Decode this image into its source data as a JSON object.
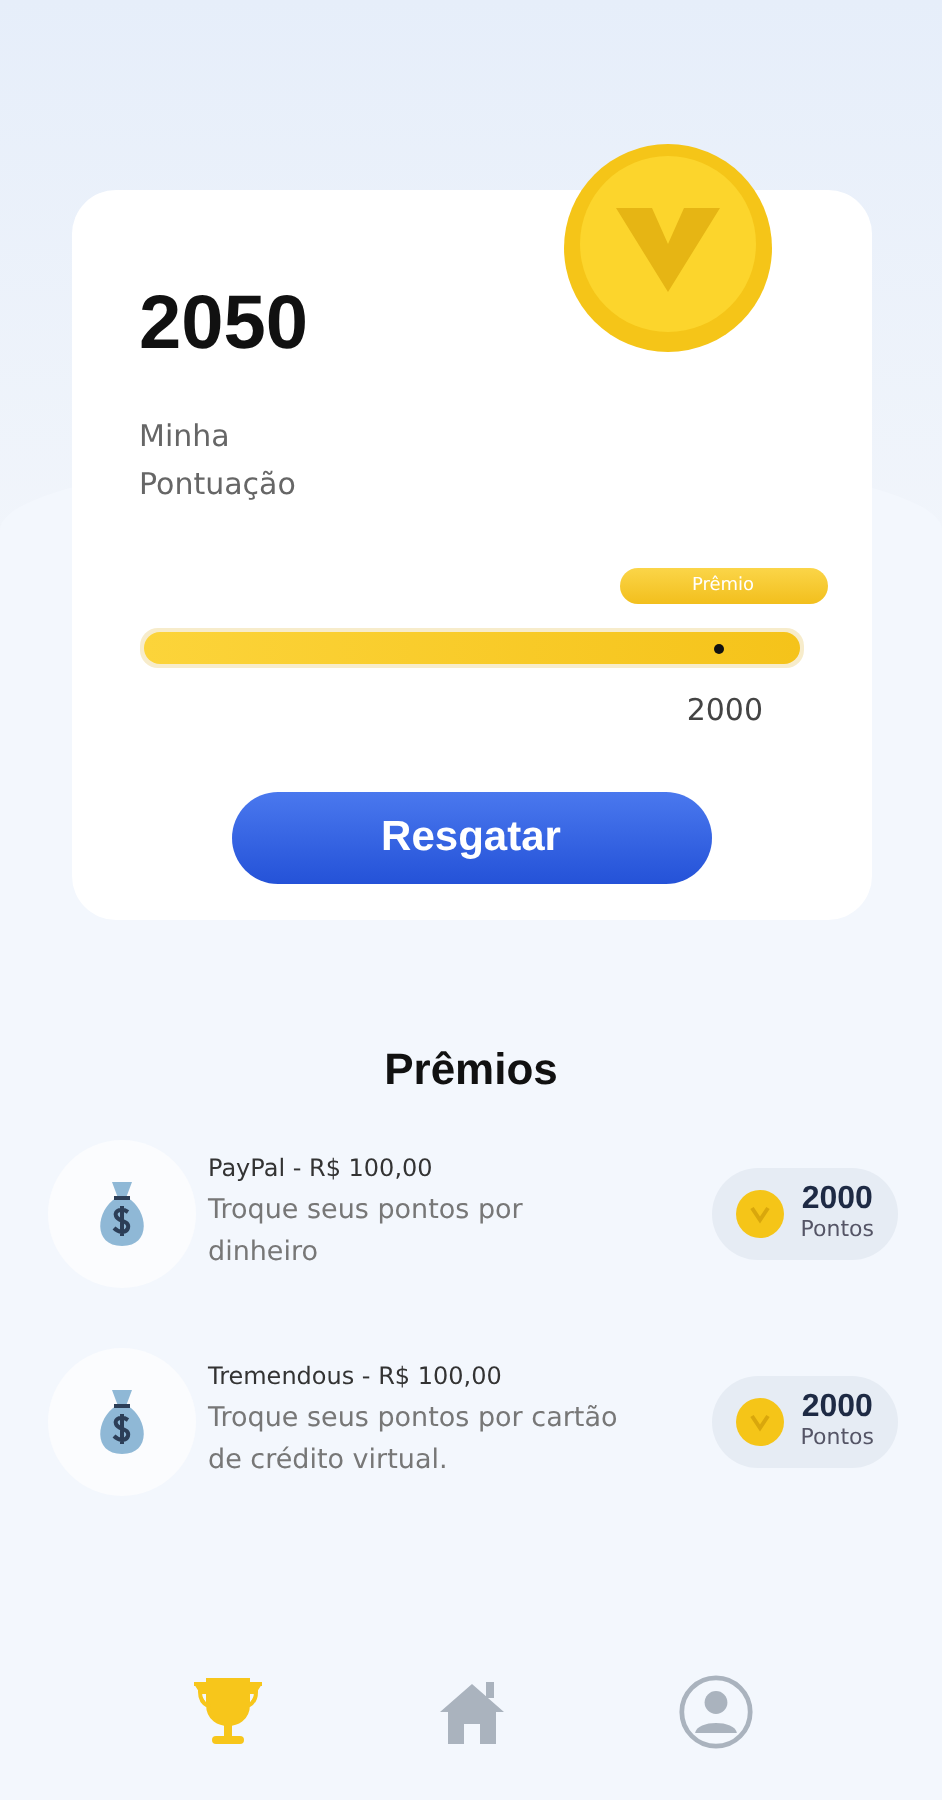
{
  "score": {
    "value": "2050",
    "label_line_1": "Minha",
    "label_line_2": "Pontuação"
  },
  "progress": {
    "badge": "Prêmio",
    "level": 1,
    "target": "2000"
  },
  "redeem_button": "Resgatar",
  "rewards_title": "Prêmios",
  "rewards": [
    {
      "title": "PayPal - R$ 100,00",
      "description": "Troque seus pontos por dinheiro",
      "points": "2000",
      "points_label": "Pontos"
    },
    {
      "title": "Tremendous - R$ 100,00",
      "description": "Troque seus pontos por cartão de crédito virtual.",
      "points": "2000",
      "points_label": "Pontos"
    }
  ],
  "nav": [
    {
      "kind": "trophy",
      "selected": true
    },
    {
      "kind": "home",
      "selected": false
    },
    {
      "kind": "profile",
      "selected": false
    }
  ]
}
